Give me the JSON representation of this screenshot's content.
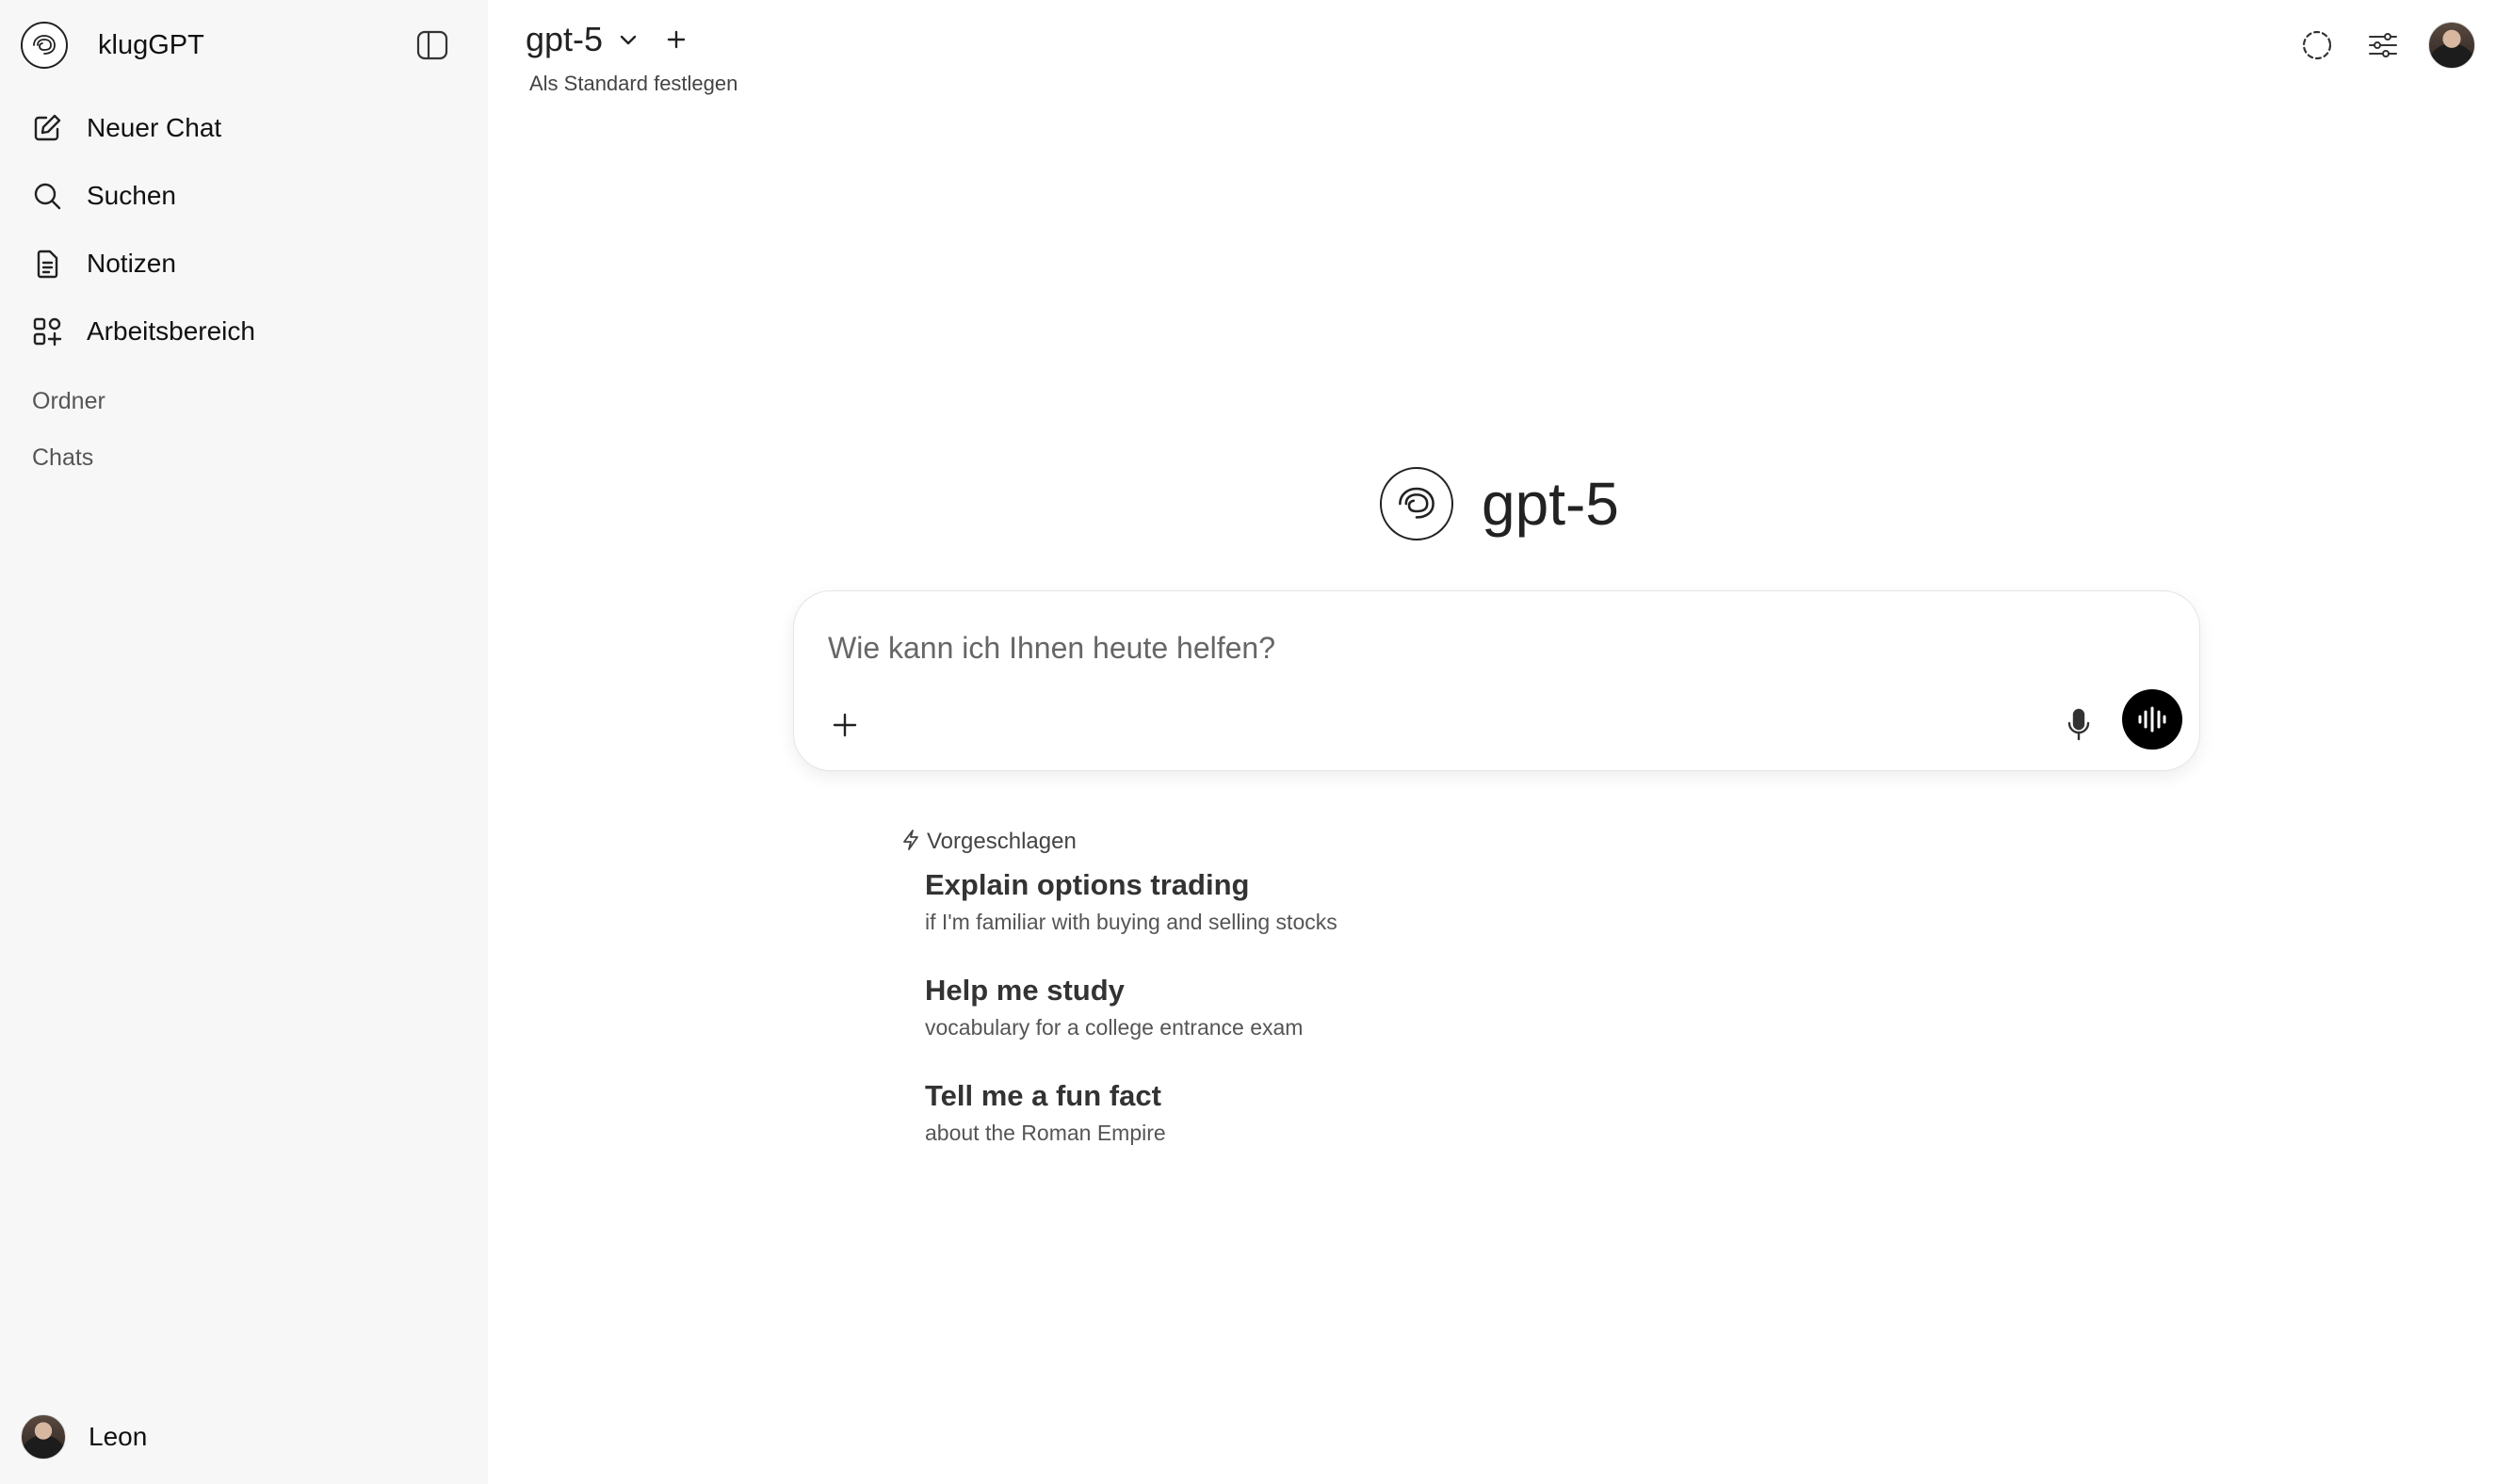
{
  "sidebar": {
    "brand": "klugGPT",
    "items": [
      {
        "label": "Neuer Chat",
        "icon": "compose-icon"
      },
      {
        "label": "Suchen",
        "icon": "search-icon"
      },
      {
        "label": "Notizen",
        "icon": "notes-icon"
      },
      {
        "label": "Arbeitsbereich",
        "icon": "workspace-icon"
      }
    ],
    "sections": {
      "folders": "Ordner",
      "chats": "Chats"
    },
    "user": {
      "name": "Leon"
    }
  },
  "header": {
    "model": "gpt-5",
    "set_default": "Als Standard festlegen",
    "icons": [
      "temporary-chat-icon",
      "controls-icon",
      "user-avatar"
    ]
  },
  "hero": {
    "title": "gpt-5"
  },
  "composer": {
    "placeholder": "Wie kann ich Ihnen heute helfen?",
    "icons": [
      "plus-icon",
      "microphone-icon",
      "voice-mode-icon"
    ]
  },
  "suggestions": {
    "heading": "Vorgeschlagen",
    "items": [
      {
        "title": "Explain options trading",
        "subtitle": "if I'm familiar with buying and selling stocks"
      },
      {
        "title": "Help me study",
        "subtitle": "vocabulary for a college entrance exam"
      },
      {
        "title": "Tell me a fun fact",
        "subtitle": "about the Roman Empire"
      }
    ]
  },
  "colors": {
    "sidebar_bg": "#f7f7f8",
    "voice_button": "#000000",
    "text": "#111111"
  }
}
